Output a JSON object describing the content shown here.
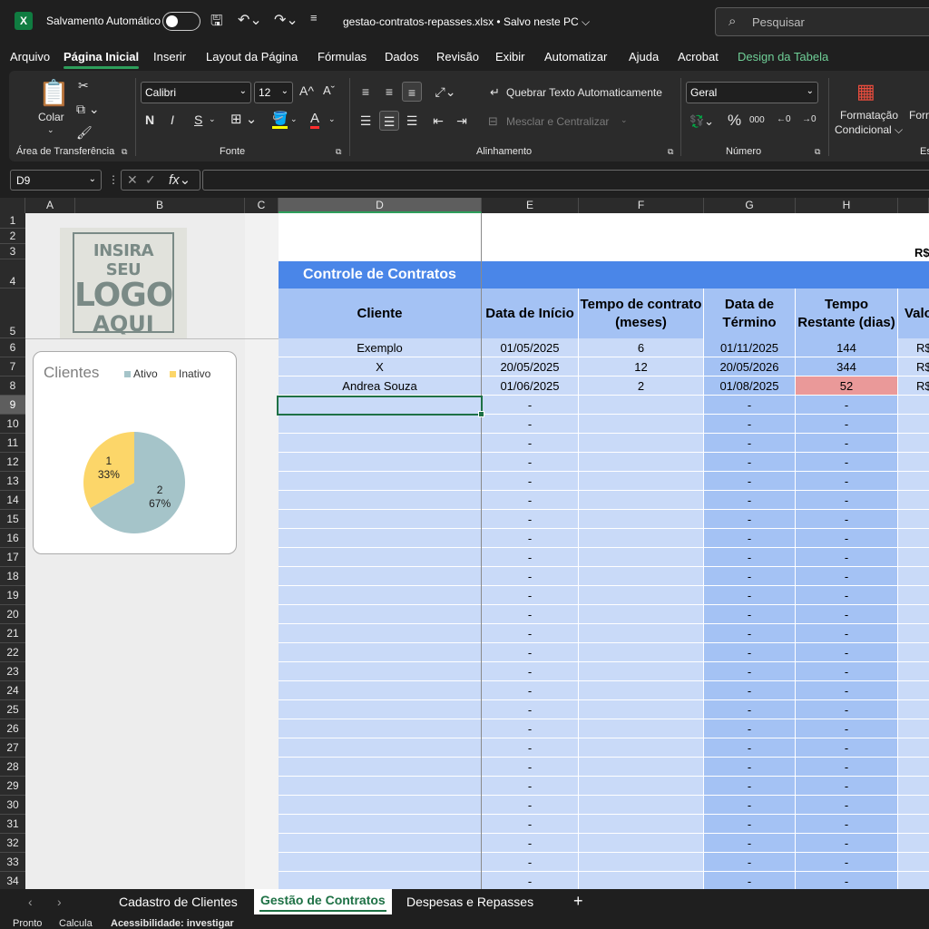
{
  "titlebar": {
    "autosave_label": "Salvamento Automático",
    "file_name": "gestao-contratos-repasses.xlsx • Salvo neste PC ⌵",
    "search_placeholder": "Pesquisar"
  },
  "menu": [
    "Arquivo",
    "Página Inicial",
    "Inserir",
    "Layout da Página",
    "Fórmulas",
    "Dados",
    "Revisão",
    "Exibir",
    "Automatizar",
    "Ajuda",
    "Acrobat",
    "Design da Tabela"
  ],
  "ribbon": {
    "paste_label": "Colar",
    "clipboard_group": "Área de Transferência",
    "font_name": "Calibri",
    "font_size": "12",
    "font_group": "Fonte",
    "wrap_text": "Quebrar Texto Automaticamente",
    "merge_center": "Mesclar e Centralizar",
    "alignment_group": "Alinhamento",
    "number_format": "Geral",
    "number_group": "Número",
    "cond_format_1": "Formatação",
    "cond_format_2": "Condicional ⌵",
    "format_partial": "Forr",
    "style_partial": "Es",
    "bold": "N",
    "italic": "I",
    "underline": "S"
  },
  "formula_bar": {
    "name_box": "D9",
    "formula": ""
  },
  "columns": [
    "A",
    "B",
    "C",
    "D",
    "E",
    "F",
    "G",
    "H"
  ],
  "rows": [
    "1",
    "2",
    "3",
    "4",
    "5",
    "6",
    "7",
    "8",
    "9",
    "10",
    "11",
    "12",
    "13",
    "14",
    "15",
    "16",
    "17",
    "18",
    "19",
    "20",
    "21",
    "22",
    "23",
    "24",
    "25",
    "26",
    "27",
    "28",
    "29",
    "30",
    "31",
    "32",
    "33",
    "34"
  ],
  "logo": {
    "line1": "INSIRA SEU",
    "line2": "LOGO",
    "line3": "AQUI"
  },
  "chart_data": {
    "type": "pie",
    "title": "Clientes",
    "categories": [
      "Ativo",
      "Inativo"
    ],
    "values": [
      2,
      1
    ],
    "percent_labels": [
      "67%",
      "33%"
    ],
    "colors": [
      "#a5c4c9",
      "#fcd669"
    ],
    "legend": "top"
  },
  "table": {
    "title": "Controle de Contratos",
    "r3_text": "R$",
    "headers": [
      "Cliente",
      "Data de Início",
      "Tempo de contrato (meses)",
      "Data de Término",
      "Tempo Restante (dias)",
      "Valo"
    ],
    "rows": [
      [
        "Exemplo",
        "01/05/2025",
        "6",
        "01/11/2025",
        "144",
        "R$"
      ],
      [
        "X",
        "20/05/2025",
        "12",
        "20/05/2026",
        "344",
        "R$"
      ],
      [
        "Andrea Souza",
        "01/06/2025",
        "2",
        "01/08/2025",
        "52",
        "R$"
      ]
    ],
    "empty_marker": "-",
    "highlight_color": "#ea9999"
  },
  "sheets": [
    "Cadastro de Clientes",
    "Gestão de Contratos",
    "Despesas e Repasses"
  ],
  "status": {
    "ready": "Pronto",
    "calc": "Calcula",
    "accessibility": "Acessibilidade: investigar"
  }
}
